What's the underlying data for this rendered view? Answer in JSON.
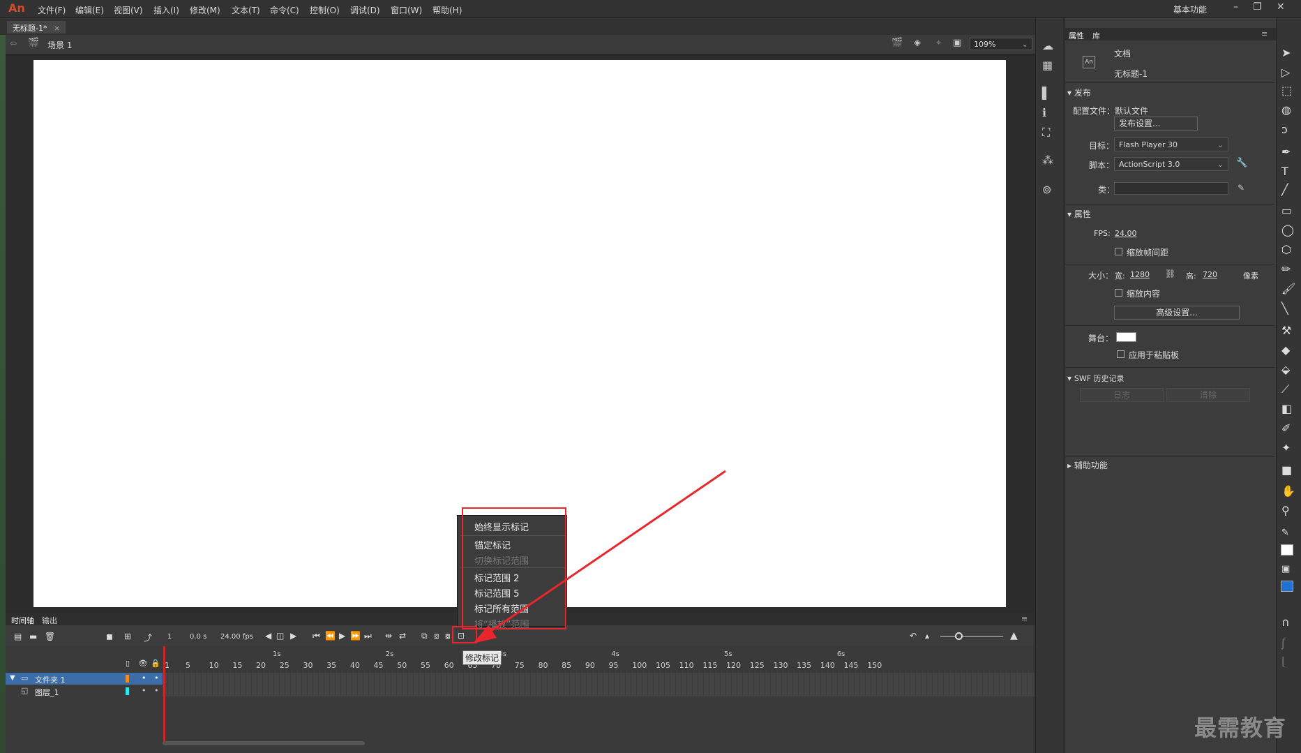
{
  "app": {
    "logo": "An"
  },
  "menu": [
    "文件(F)",
    "编辑(E)",
    "视图(V)",
    "插入(I)",
    "修改(M)",
    "文本(T)",
    "命令(C)",
    "控制(O)",
    "调试(D)",
    "窗口(W)",
    "帮助(H)"
  ],
  "workspace": "基本功能",
  "doc_tab": {
    "label": "无标题-1*",
    "close": "×"
  },
  "scene": "场景 1",
  "zoom": "109%",
  "context_menu": {
    "items": [
      {
        "label": "始终显示标记",
        "disabled": false
      },
      {
        "label": "锚定标记",
        "disabled": false
      },
      {
        "label": "切换标记范围",
        "disabled": true
      },
      {
        "label": "标记范围 2",
        "disabled": false
      },
      {
        "label": "标记范围 5",
        "disabled": false
      },
      {
        "label": "标记所有范围",
        "disabled": false
      },
      {
        "label": "将“播放”范围",
        "disabled": true
      }
    ],
    "tooltip": "修改标记"
  },
  "timeline": {
    "tabs": [
      "时间轴",
      "输出"
    ],
    "current_frame": "1",
    "time": "0.0 s",
    "fps": "24.00 fps",
    "seconds": [
      "1s",
      "2s",
      "3s",
      "4s",
      "5s",
      "6s"
    ],
    "ticks": [
      "1",
      "5",
      "10",
      "15",
      "20",
      "25",
      "30",
      "35",
      "40",
      "45",
      "50",
      "55",
      "60",
      "65",
      "70",
      "75",
      "80",
      "85",
      "90",
      "95",
      "100",
      "105",
      "110",
      "115",
      "120",
      "125",
      "130",
      "135",
      "140",
      "145",
      "150"
    ],
    "layers": [
      {
        "name": "文件夹 1",
        "color": "#f08a24"
      },
      {
        "name": "图层_1",
        "color": "#2ee6f0"
      }
    ]
  },
  "properties": {
    "tabs": [
      "属性",
      "库"
    ],
    "doc_type": "文档",
    "doc_name": "无标题-1",
    "publish_section": "发布",
    "profile_label": "配置文件：",
    "profile_value": "默认文件",
    "publish_settings": "发布设置...",
    "target_label": "目标：",
    "target_value": "Flash Player 30",
    "script_label": "脚本：",
    "script_value": "ActionScript 3.0",
    "class_label": "类：",
    "props_section": "属性",
    "fps_label": "FPS:",
    "fps_value": "24.00",
    "scale_spans": "缩放帧间距",
    "size_label": "大小：",
    "width_label": "宽:",
    "width_value": "1280",
    "height_label": "高:",
    "height_value": "720",
    "units": "像素",
    "scale_content": "缩放内容",
    "advanced": "高级设置...",
    "stage_label": "舞台：",
    "apply_pasteboard": "应用于粘贴板",
    "swf_section": "SWF 历史记录",
    "log_btn": "日志",
    "clear_btn": "清除",
    "accessibility_section": "辅助功能"
  },
  "watermark": "最需教育"
}
